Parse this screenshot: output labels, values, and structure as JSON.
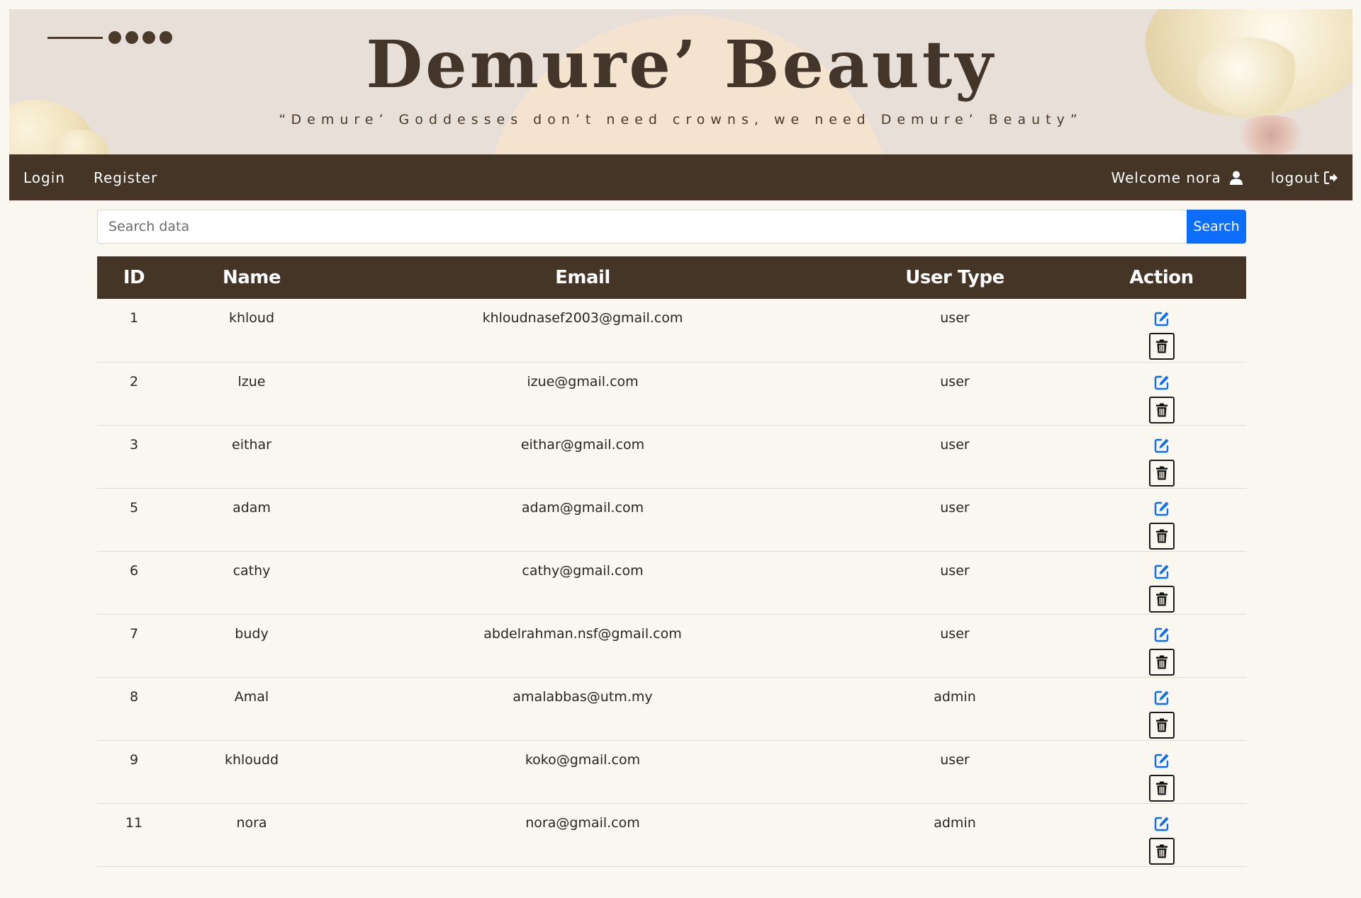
{
  "brand": {
    "title": "Demure’ Beauty",
    "tagline": "“Demure’ Goddesses don’t need crowns, we need Demure’ Beauty”"
  },
  "nav": {
    "login": "Login",
    "register": "Register",
    "welcome": "Welcome nora",
    "logout": "logout"
  },
  "search": {
    "placeholder": "Search data",
    "value": "",
    "button_label": "Search"
  },
  "table": {
    "headers": [
      "ID",
      "Name",
      "Email",
      "User Type",
      "Action"
    ],
    "rows": [
      {
        "id": "1",
        "name": "khloud",
        "email": "khloudnasef2003@gmail.com",
        "type": "user"
      },
      {
        "id": "2",
        "name": "lzue",
        "email": "izue@gmail.com",
        "type": "user"
      },
      {
        "id": "3",
        "name": "eithar",
        "email": "eithar@gmail.com",
        "type": "user"
      },
      {
        "id": "5",
        "name": "adam",
        "email": "adam@gmail.com",
        "type": "user"
      },
      {
        "id": "6",
        "name": "cathy",
        "email": "cathy@gmail.com",
        "type": "user"
      },
      {
        "id": "7",
        "name": "budy",
        "email": "abdelrahman.nsf@gmail.com",
        "type": "user"
      },
      {
        "id": "8",
        "name": "Amal",
        "email": "amalabbas@utm.my",
        "type": "admin"
      },
      {
        "id": "9",
        "name": "khloudd",
        "email": "koko@gmail.com",
        "type": "user"
      },
      {
        "id": "11",
        "name": "nora",
        "email": "nora@gmail.com",
        "type": "admin"
      }
    ]
  },
  "icons": {
    "user": "user-icon",
    "logout": "sign-out-icon",
    "edit": "edit-icon",
    "delete": "trash-icon"
  },
  "colors": {
    "brand_dark": "#443527",
    "banner_bg": "#e8dfd9",
    "page_bg": "#faf7f1",
    "accent_blue": "#0d6efd"
  }
}
